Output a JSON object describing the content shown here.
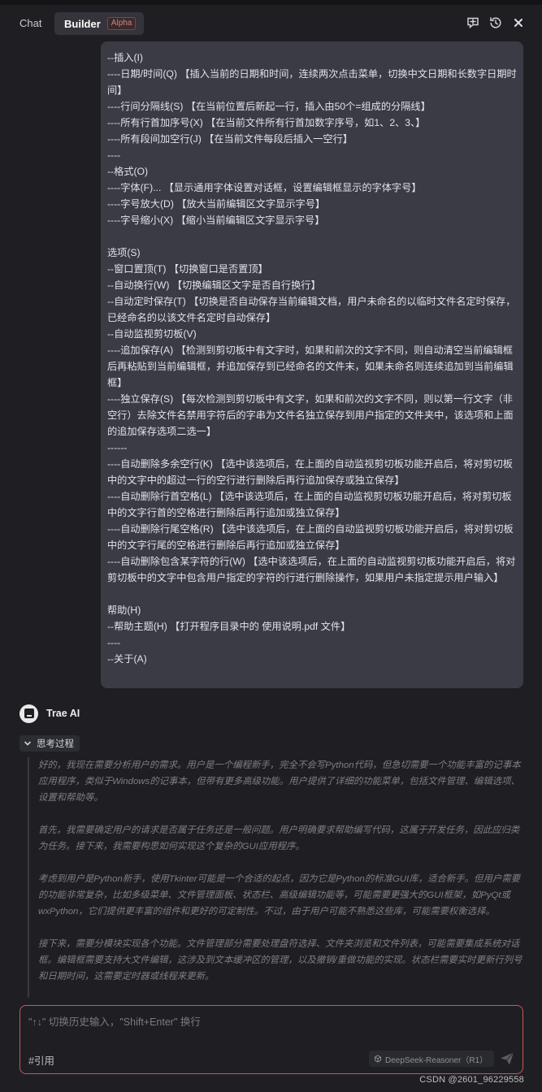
{
  "header": {
    "tab_chat": "Chat",
    "tab_builder": "Builder",
    "builder_badge": "Alpha",
    "icons": [
      "new-chat-icon",
      "history-icon",
      "close-icon"
    ]
  },
  "user_message": {
    "lines": [
      "--插入(I)",
      "----日期/时间(Q) 【插入当前的日期和时间，连续两次点击菜单，切换中文日期和长数字日期时间】",
      "----行间分隔线(S) 【在当前位置后新起一行，插入由50个=组成的分隔线】",
      "----所有行首加序号(X) 【在当前文件所有行首加数字序号，如1、2、3、】",
      "----所有段间加空行(J) 【在当前文件每段后插入一空行】",
      "----",
      "--格式(O)",
      "----字体(F)... 【显示通用字体设置对话框，设置编辑框显示的字体字号】",
      "----字号放大(D) 【放大当前编辑区文字显示字号】",
      "----字号缩小(X) 【缩小当前编辑区文字显示字号】",
      "",
      "选项(S)",
      "--窗口置顶(T) 【切换窗口是否置顶】",
      "--自动换行(W) 【切换编辑区文字是否自行换行】",
      "--自动定时保存(T) 【切换是否自动保存当前编辑文档，用户未命名的以临时文件名定时保存，已经命名的以该文件名定时自动保存】",
      "--自动监视剪切板(V)",
      "----追加保存(A) 【检测到剪切板中有文字时，如果和前次的文字不同，则自动清空当前编辑框后再粘贴到当前编辑框，并追加保存到已经命名的文件末，如果未命名则连续追加到当前编辑框】",
      "----独立保存(S) 【每次检测到剪切板中有文字，如果和前次的文字不同，则以第一行文字（非空行）去除文件名禁用字符后的字串为文件名独立保存到用户指定的文件夹中，该选项和上面的追加保存选项二选一】",
      "------",
      "----自动删除多余空行(K) 【选中该选项后，在上面的自动监视剪切板功能开启后，将对剪切板中的文字中的超过一行的空行进行删除后再行追加保存或独立保存】",
      "----自动删除行首空格(L) 【选中该选项后，在上面的自动监视剪切板功能开启后，将对剪切板中的文字行首的空格进行删除后再行追加或独立保存】",
      "----自动删除行尾空格(R) 【选中该选项后，在上面的自动监视剪切板功能开启后，将对剪切板中的文字行尾的空格进行删除后再行追加或独立保存】",
      "----自动删除包含某字符的行(W) 【选中该选项后，在上面的自动监视剪切板功能开启后，将对剪切板中的文字中包含用户指定的字符的行进行删除操作，如果用户未指定提示用户输入】",
      "",
      "帮助(H)",
      "--帮助主题(H) 【打开程序目录中的 使用说明.pdf 文件】",
      "----",
      "--关于(A)"
    ]
  },
  "assistant": {
    "name": "Trae AI",
    "thinking_label": "思考过程",
    "thinking_paragraphs": [
      "好的，我现在需要分析用户的需求。用户是一个编程新手，完全不会写Python代码，但急切需要一个功能丰富的记事本应用程序，类似于Windows的记事本，但带有更多高级功能。用户提供了详细的功能菜单，包括文件管理、编辑选项、设置和帮助等。",
      "首先，我需要确定用户的请求是否属于任务还是一般问题。用户明确要求帮助编写代码，这属于开发任务，因此应归类为任务。接下来，我需要构思如何实现这个复杂的GUI应用程序。",
      "考虑到用户是Python新手，使用Tkinter可能是一个合适的起点，因为它是Python的标准GUI库，适合新手。但用户需要的功能非常复杂，比如多级菜单、文件管理面板、状态栏、高级编辑功能等，可能需要更强大的GUI框架，如PyQt或wxPython，它们提供更丰富的组件和更好的可定制性。不过，由于用户可能不熟悉这些库，可能需要权衡选择。",
      "接下来，需要分模块实现各个功能。文件管理部分需要处理盘符选择、文件夹浏览和文件列表，可能需要集成系统对话框。编辑框需要支持大文件编辑，这涉及到文本缓冲区的管理，以及撤销/重做功能的实现。状态栏需要实时更新行列号和日期时间，这需要定时器或线程来更新。"
    ]
  },
  "composer": {
    "placeholder": "\"↑↓\" 切换历史输入，\"Shift+Enter\" 换行",
    "value": "",
    "ref_label": "#引用",
    "model_label": "DeepSeek-Reasoner（R1）"
  },
  "watermark": "CSDN @2601_96229558"
}
